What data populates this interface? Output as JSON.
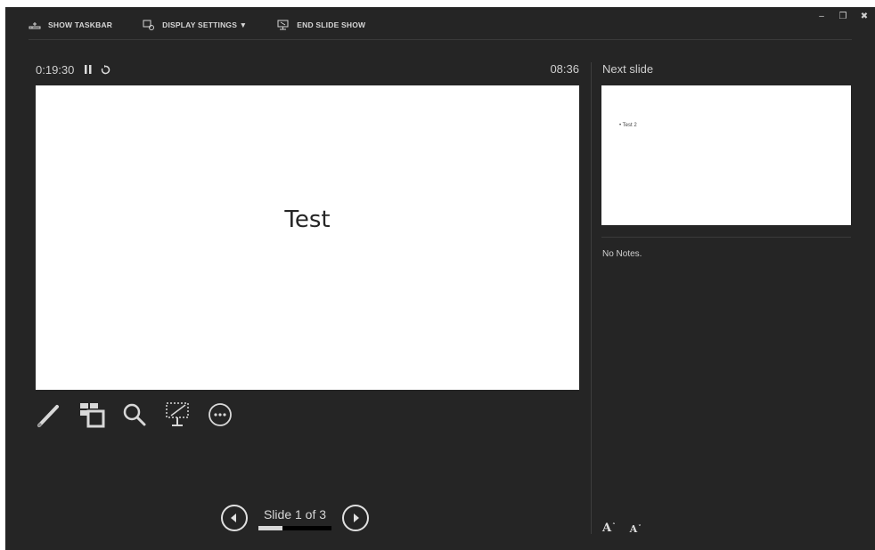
{
  "toolbar": {
    "show_taskbar": "SHOW TASKBAR",
    "display_settings": "DISPLAY SETTINGS ▼",
    "end_slide_show": "END SLIDE SHOW"
  },
  "window_controls": {
    "minimize": "–",
    "restore": "❐",
    "close": "✖"
  },
  "timer": {
    "elapsed": "0:19:30",
    "clock": "08:36"
  },
  "current_slide": {
    "title": "Test"
  },
  "tools": [
    "pen-icon",
    "see-all-slides-icon",
    "zoom-icon",
    "black-screen-icon",
    "more-options-icon"
  ],
  "navigation": {
    "counter": "Slide 1 of 3",
    "current": 1,
    "total": 3
  },
  "next_slide": {
    "label": "Next slide",
    "bullet": "• Test 2"
  },
  "notes": {
    "text": "No Notes."
  },
  "font_controls": {
    "increase": "A",
    "decrease": "A"
  },
  "colors": {
    "background": "#252525",
    "text": "#cfcfcf",
    "slide": "#ffffff"
  }
}
